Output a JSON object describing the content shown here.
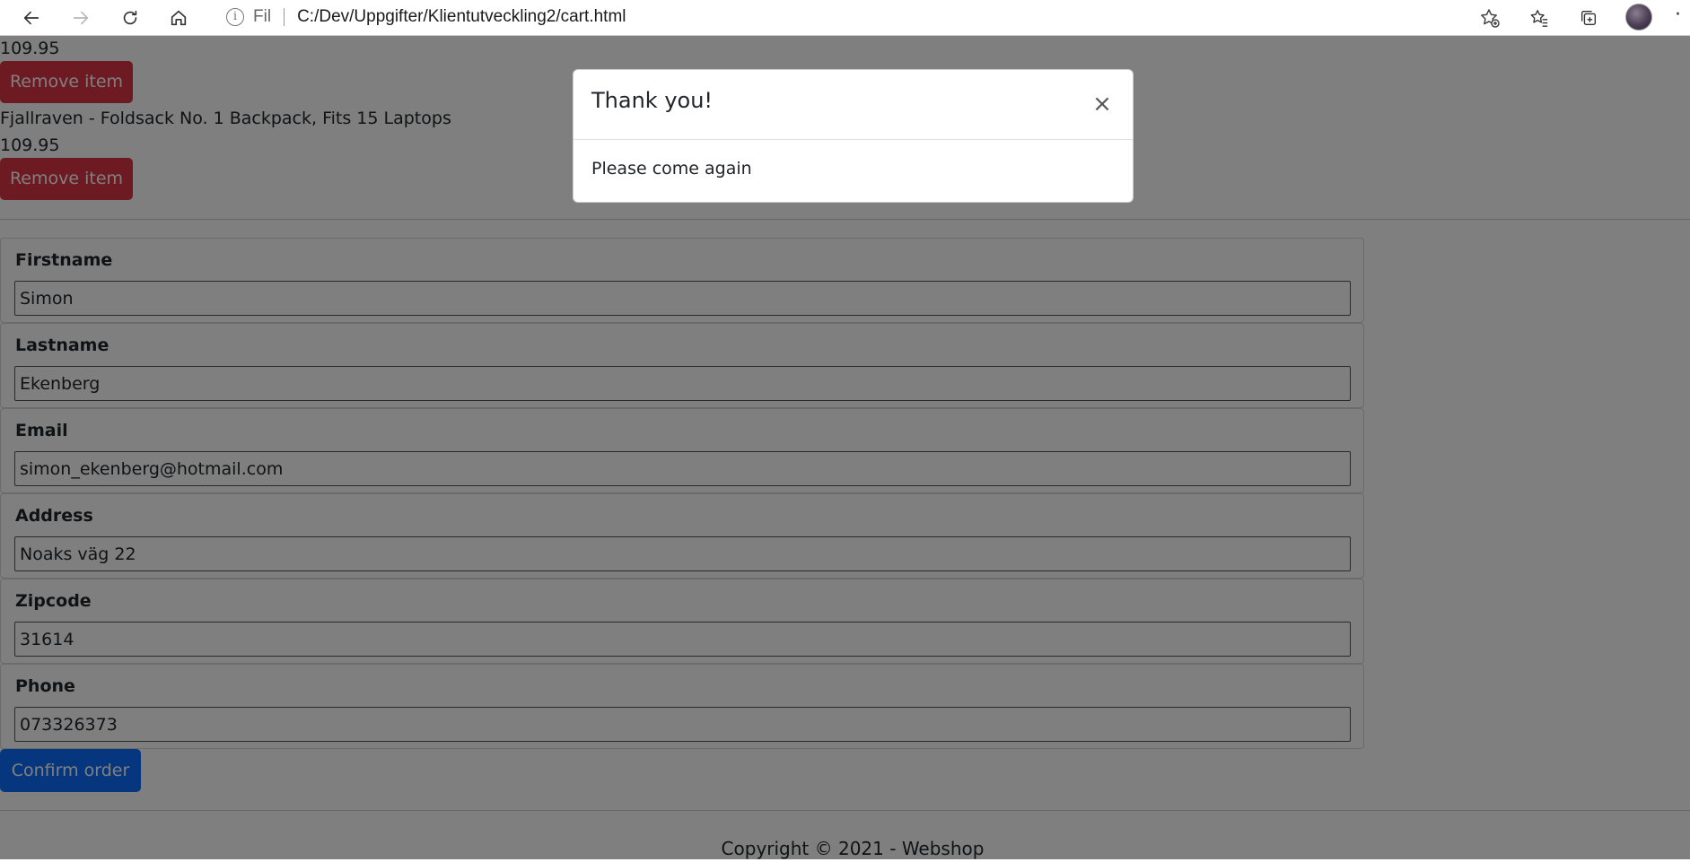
{
  "browser": {
    "address_scheme": "Fil",
    "url": "C:/Dev/Uppgifter/Klientutveckling2/cart.html",
    "icons": [
      "back-icon",
      "forward-icon",
      "refresh-icon",
      "home-icon",
      "info-icon",
      "add-favorite-icon",
      "favorites-icon",
      "collections-icon",
      "profile-avatar",
      "more-icon"
    ]
  },
  "cart": {
    "items": [
      {
        "price": "109.95",
        "remove_label": "Remove item"
      },
      {
        "name": "Fjallraven - Foldsack No. 1 Backpack, Fits 15 Laptops",
        "price": "109.95",
        "remove_label": "Remove item"
      }
    ]
  },
  "form": {
    "fields": [
      {
        "label": "Firstname",
        "value": "Simon"
      },
      {
        "label": "Lastname",
        "value": "Ekenberg"
      },
      {
        "label": "Email",
        "value": "simon_ekenberg@hotmail.com"
      },
      {
        "label": "Address",
        "value": "Noaks väg 22"
      },
      {
        "label": "Zipcode",
        "value": "31614"
      },
      {
        "label": "Phone",
        "value": "073326373"
      }
    ],
    "confirm_label": "Confirm order"
  },
  "footer": {
    "text": "Copyright © 2021 - Webshop"
  },
  "modal": {
    "title": "Thank you!",
    "body": "Please come again",
    "close_glyph": "×"
  },
  "colors": {
    "danger": "#dc3545",
    "primary": "#0d6efd",
    "backdrop": "rgba(0,0,0,0.5)"
  }
}
